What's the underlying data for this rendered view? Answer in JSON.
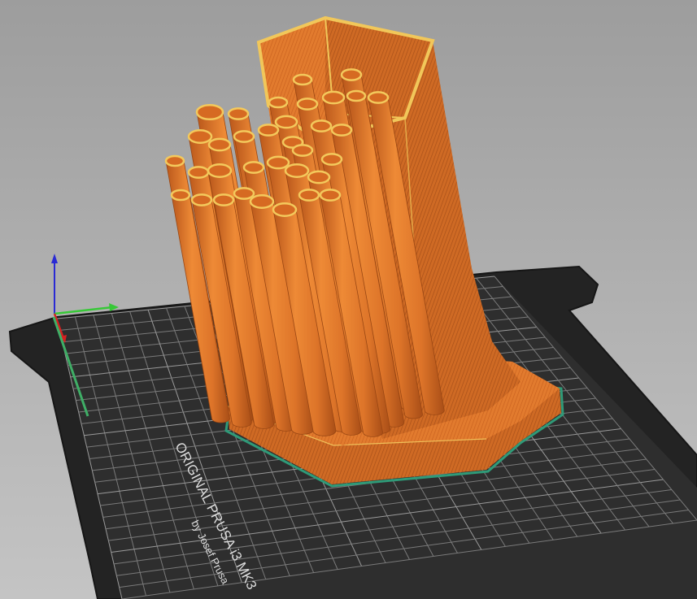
{
  "bed": {
    "brand_line": "ORIGINAL PRUSA i3  MK3",
    "byline": "by Josef Prusa"
  },
  "colors": {
    "background_top": "#9d9d9d",
    "background_bottom": "#c2c2c2",
    "bed_plate": "#2b2b2b",
    "bed_grid": "#7a7a7a",
    "model_orange": "#e27b2e",
    "model_shadow": "#b5561a",
    "model_top_yellow": "#e8b94a",
    "brim_green": "#2f9a78",
    "axis_x": "#37c837",
    "axis_y": "#d42020",
    "axis_z": "#2a2ad4"
  },
  "icons": [
    "axis-gizmo-icon"
  ]
}
